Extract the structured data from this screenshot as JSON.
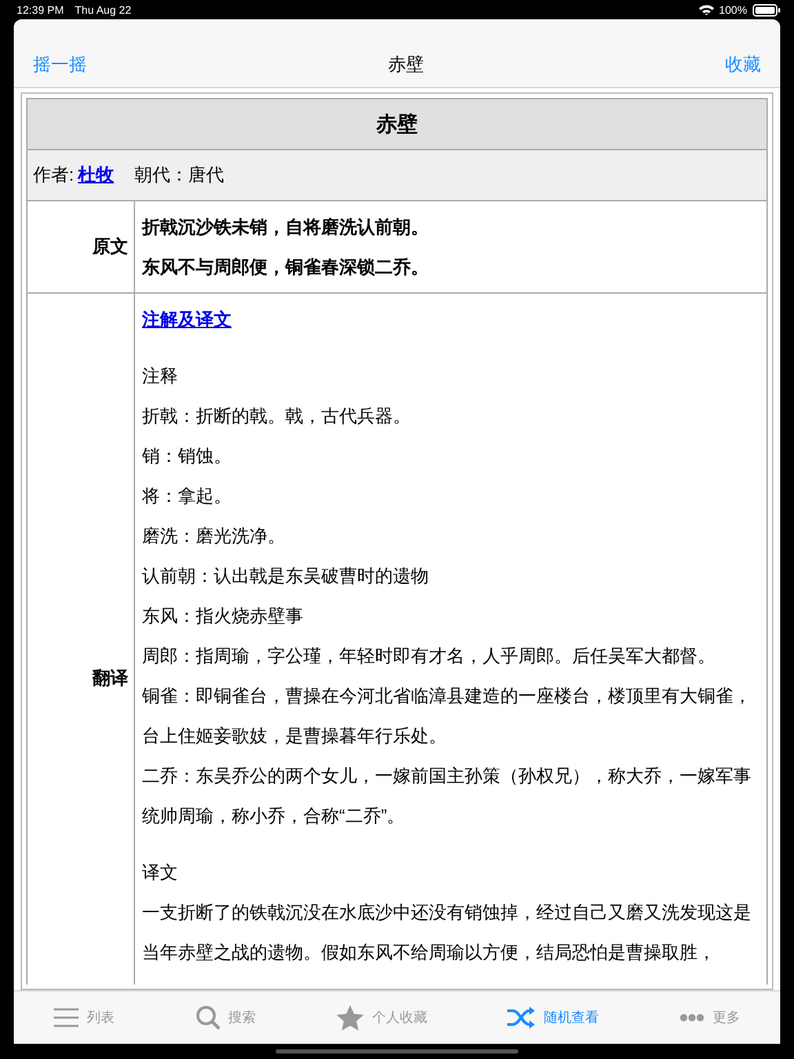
{
  "status_bar": {
    "time": "12:39 PM",
    "date": "Thu Aug 22",
    "battery": "100%"
  },
  "nav": {
    "left": "摇一摇",
    "title": "赤壁",
    "right": "收藏"
  },
  "poem": {
    "title": "赤壁",
    "author_label": "作者:",
    "author": "杜牧",
    "dynasty": "朝代：唐代",
    "original_label": "原文",
    "original": [
      "折戟沉沙铁未销，自将磨洗认前朝。",
      "东风不与周郎便，铜雀春深锁二乔。"
    ],
    "translation_label": "翻译",
    "notes_link": "注解及译文",
    "notes_heading": "注释",
    "notes": [
      "折戟：折断的戟。戟，古代兵器。",
      "销：销蚀。",
      "将：拿起。",
      "磨洗：磨光洗净。",
      "认前朝：认出戟是东吴破曹时的遗物",
      "东风：指火烧赤壁事",
      "周郎：指周瑜，字公瑾，年轻时即有才名，人乎周郎。后任吴军大都督。",
      "铜雀：即铜雀台，曹操在今河北省临漳县建造的一座楼台，楼顶里有大铜雀，台上住姬妾歌妓，是曹操暮年行乐处。",
      "二乔：东吴乔公的两个女儿，一嫁前国主孙策（孙权兄），称大乔，一嫁军事统帅周瑜，称小乔，合称“二乔”。"
    ],
    "translation_heading": "译文",
    "translation": "一支折断了的铁戟沉没在水底沙中还没有销蚀掉，经过自己又磨又洗发现这是当年赤壁之战的遗物。假如东风不给周瑜以方便，结局恐怕是曹操取胜，"
  },
  "tabs": [
    {
      "kind": "list",
      "label": "列表",
      "selected": false
    },
    {
      "kind": "search",
      "label": "搜索",
      "selected": false
    },
    {
      "kind": "star",
      "label": "个人收藏",
      "selected": false
    },
    {
      "kind": "shuffle",
      "label": "随机查看",
      "selected": true
    },
    {
      "kind": "more",
      "label": "更多",
      "selected": false
    }
  ]
}
